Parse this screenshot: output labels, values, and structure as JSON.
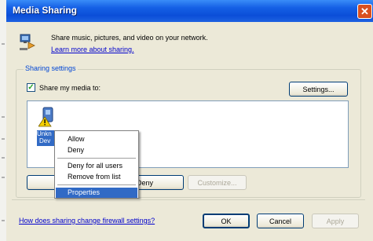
{
  "window": {
    "title": "Media Sharing",
    "close_glyph": "✕"
  },
  "intro": {
    "text": "Share music, pictures, and video on your network.",
    "link": "Learn more about sharing."
  },
  "sharing_settings": {
    "label": "Sharing settings",
    "share_checkbox_label": "Share my media to:",
    "share_checked": true,
    "settings_button": "Settings..."
  },
  "device": {
    "label_line1": "Unkn",
    "label_line2": "Dev"
  },
  "context_menu": {
    "items": [
      "Allow",
      "Deny",
      "Deny for all users",
      "Remove from list",
      "Properties"
    ],
    "selected": "Properties"
  },
  "device_buttons": {
    "deny": "Deny",
    "customize": "Customize..."
  },
  "footer": {
    "firewall_link": "How does sharing change firewall settings?",
    "ok": "OK",
    "cancel": "Cancel",
    "apply": "Apply"
  },
  "colors": {
    "title_bar": "#0b4ed8",
    "dialog_bg": "#ece9d8",
    "selection": "#316ac5",
    "link": "#0000cc",
    "close": "#d9501f"
  }
}
